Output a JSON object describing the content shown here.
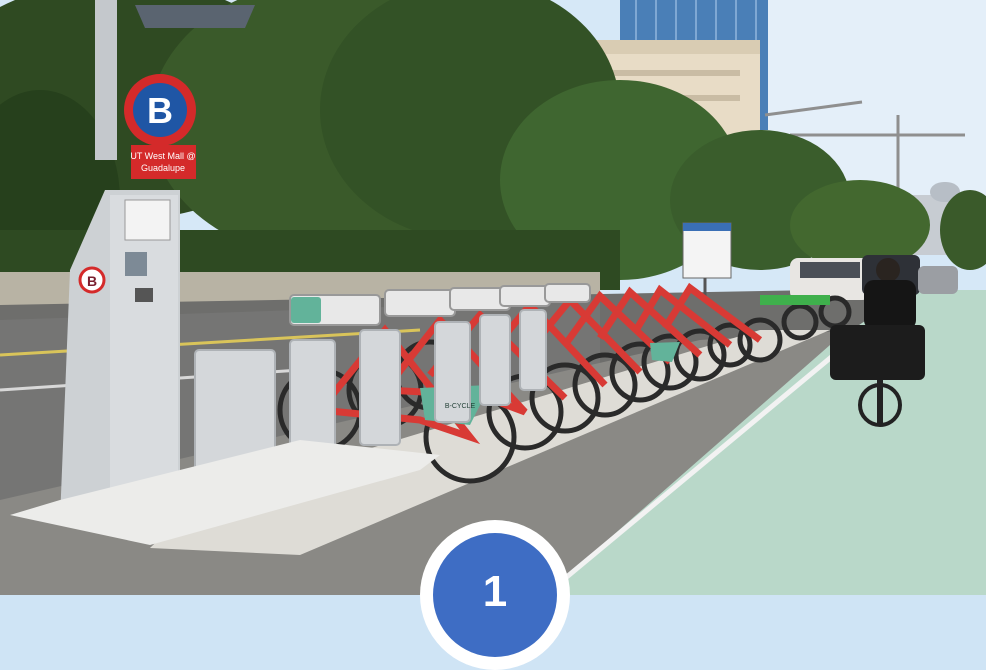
{
  "photo": {
    "station_letter": "B",
    "station_name_line1": "UT West Mall @",
    "station_name_line2": "Guadalupe",
    "kiosk_small_letter": "B",
    "bike_brand": "B-CYCLE"
  },
  "overlay": {
    "step_number": "1"
  },
  "colors": {
    "badge_blue": "#3e6dc4",
    "bike_red": "#d83a35",
    "bike_lane_green": "#b9d8c9",
    "station_sign_red": "#d42a2a"
  }
}
